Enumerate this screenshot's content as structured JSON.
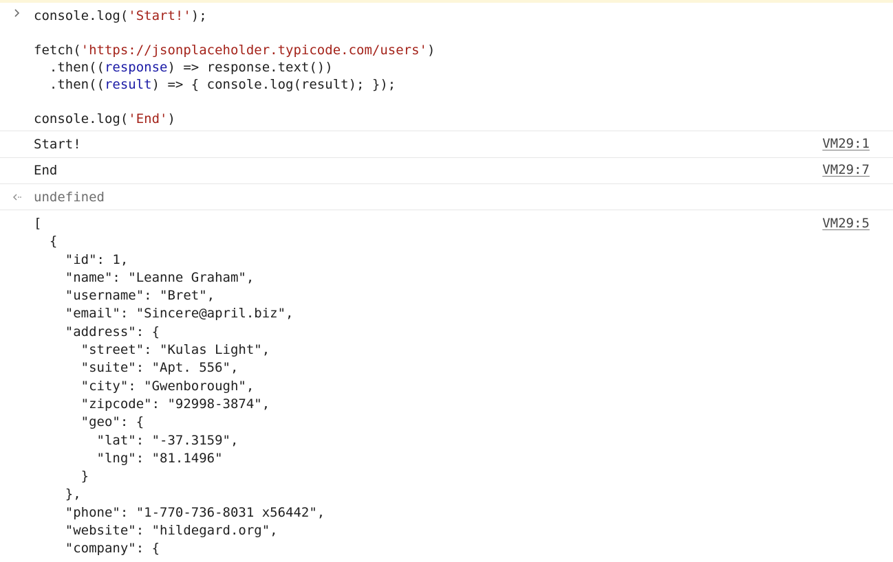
{
  "input": {
    "prompt_icon": "chevron-right-icon",
    "lines": [
      {
        "parts": [
          {
            "t": "console.log(",
            "c": ""
          },
          {
            "t": "'Start!'",
            "c": "str"
          },
          {
            "t": ");",
            "c": ""
          }
        ]
      },
      {
        "parts": [
          {
            "t": "fetch(",
            "c": ""
          },
          {
            "t": "'https://jsonplaceholder.typicode.com/users'",
            "c": "str"
          },
          {
            "t": ")",
            "c": ""
          }
        ]
      },
      {
        "parts": [
          {
            "t": "  .then((",
            "c": ""
          },
          {
            "t": "response",
            "c": "param"
          },
          {
            "t": ") => response.text())",
            "c": ""
          }
        ]
      },
      {
        "parts": [
          {
            "t": "  .then((",
            "c": ""
          },
          {
            "t": "result",
            "c": "param"
          },
          {
            "t": ") => { console.log(result); });",
            "c": ""
          }
        ]
      },
      {
        "parts": [
          {
            "t": "console.log(",
            "c": ""
          },
          {
            "t": "'End'",
            "c": "str"
          },
          {
            "t": ")",
            "c": ""
          }
        ]
      }
    ]
  },
  "logs": [
    {
      "text": "Start!",
      "source": "VM29:1"
    },
    {
      "text": "End",
      "source": "VM29:7"
    }
  ],
  "return_value": {
    "icon": "return-arrow-icon",
    "text": "undefined"
  },
  "response_log": {
    "source": "VM29:5",
    "lines": [
      "[",
      "  {",
      "    \"id\": 1,",
      "    \"name\": \"Leanne Graham\",",
      "    \"username\": \"Bret\",",
      "    \"email\": \"Sincere@april.biz\",",
      "    \"address\": {",
      "      \"street\": \"Kulas Light\",",
      "      \"suite\": \"Apt. 556\",",
      "      \"city\": \"Gwenborough\",",
      "      \"zipcode\": \"92998-3874\",",
      "      \"geo\": {",
      "        \"lat\": \"-37.3159\",",
      "        \"lng\": \"81.1496\"",
      "      }",
      "    },",
      "    \"phone\": \"1-770-736-8031 x56442\",",
      "    \"website\": \"hildegard.org\",",
      "    \"company\": {"
    ]
  }
}
